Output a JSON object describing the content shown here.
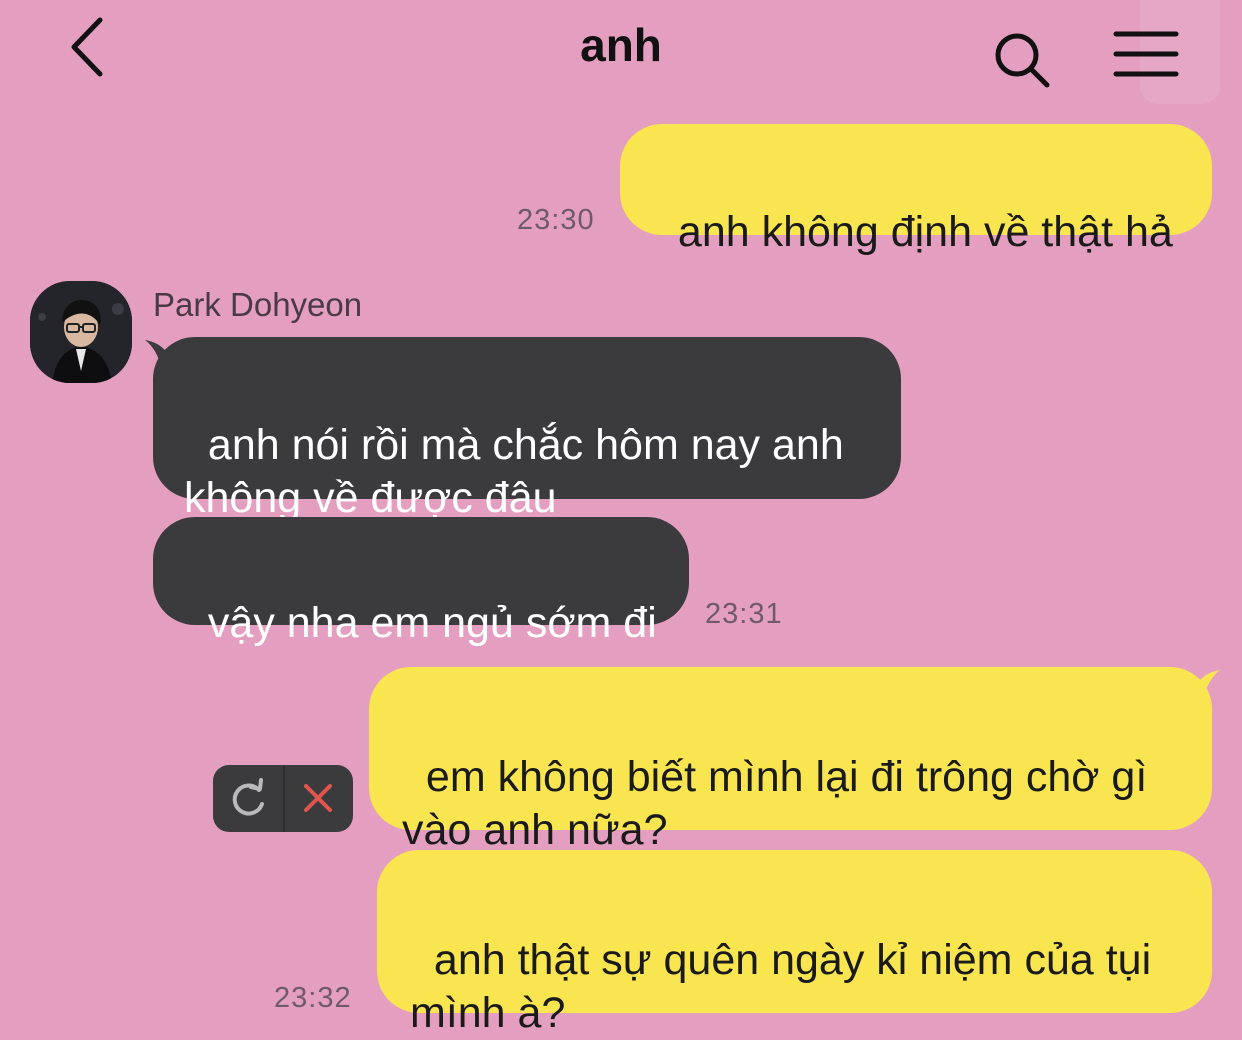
{
  "header": {
    "title": "anh",
    "icons": {
      "back": "chevron-left-icon",
      "search": "search-icon",
      "menu": "hamburger-menu-icon"
    }
  },
  "contact": {
    "name": "Park Dohyeon"
  },
  "messages": [
    {
      "from": "me",
      "text": "anh không định về thật hả",
      "time": "23:30"
    },
    {
      "from": "them",
      "text": "anh nói rồi mà chắc hôm nay anh\nkhông về được đâu"
    },
    {
      "from": "them",
      "text": "vậy nha em ngủ sớm đi",
      "time": "23:31"
    },
    {
      "from": "me",
      "text": "em không biết mình lại đi trông chờ gì\nvào anh nữa?",
      "status": "failed"
    },
    {
      "from": "me",
      "text": "anh thật sự quên ngày kỉ niệm của tụi\nmình à?",
      "time": "23:32"
    }
  ],
  "failed_actions": {
    "retry": "retry-icon",
    "delete": "close-icon"
  },
  "colors": {
    "background": "#e49ec0",
    "outgoing_bubble": "#f8e550",
    "incoming_bubble": "#3b3b3d",
    "delete_x": "#e0564e"
  }
}
